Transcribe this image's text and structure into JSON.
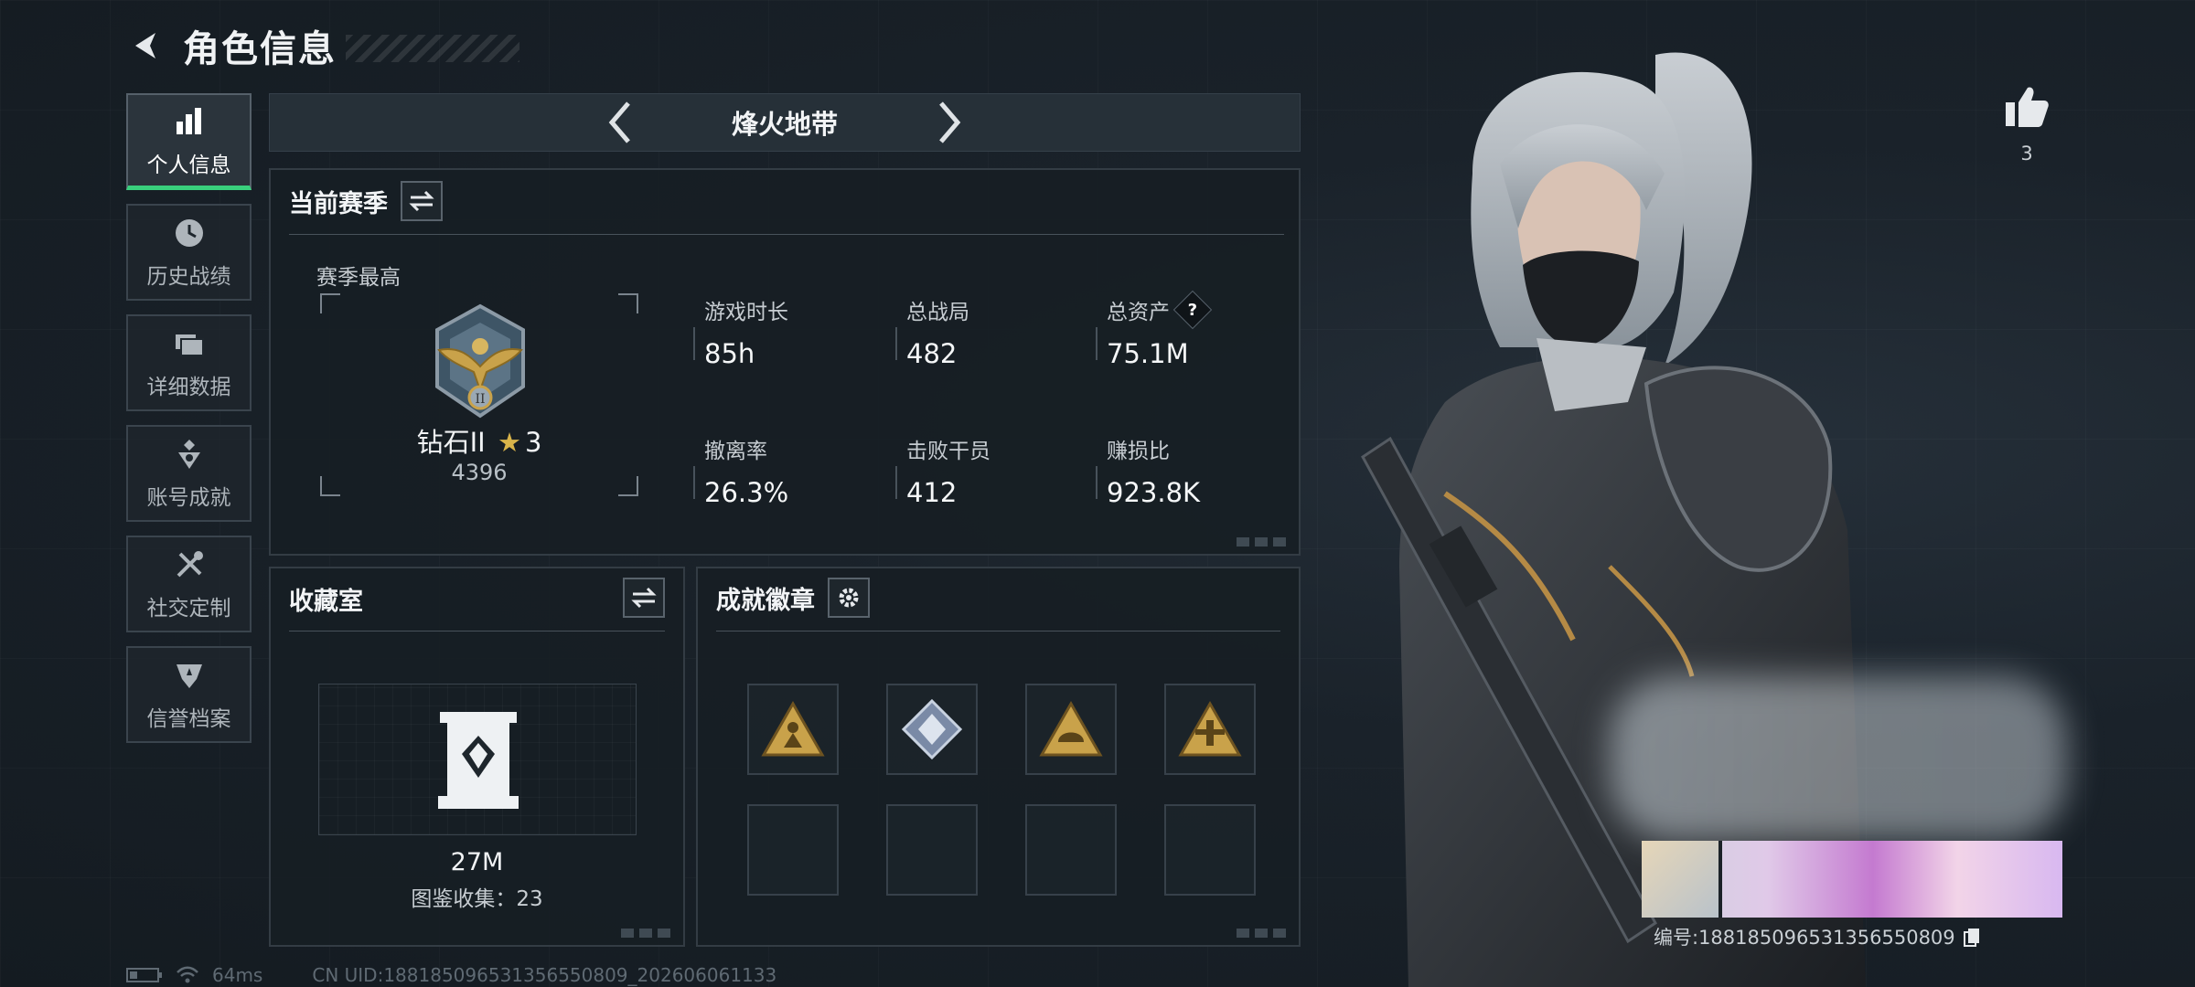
{
  "header": {
    "title": "角色信息"
  },
  "nav": [
    {
      "label": "个人信息",
      "icon": "bar-chart-icon"
    },
    {
      "label": "历史战绩",
      "icon": "clock-icon"
    },
    {
      "label": "详细数据",
      "icon": "folder-icon"
    },
    {
      "label": "账号成就",
      "icon": "trophy-icon"
    },
    {
      "label": "社交定制",
      "icon": "tools-icon"
    },
    {
      "label": "信誉档案",
      "icon": "shield-badge-icon"
    }
  ],
  "mode": {
    "title": "烽火地带"
  },
  "season": {
    "title": "当前赛季",
    "best_label": "赛季最高",
    "rank_name": "钻石II",
    "rank_stars": "3",
    "rank_score": "4396",
    "stats": [
      {
        "label": "游戏时长",
        "value": "85h"
      },
      {
        "label": "总战局",
        "value": "482"
      },
      {
        "label": "总资产",
        "value": "75.1M"
      },
      {
        "label": "撤离率",
        "value": "26.3%"
      },
      {
        "label": "击败干员",
        "value": "412"
      },
      {
        "label": "赚损比",
        "value": "923.8K"
      }
    ],
    "help_icon": "?"
  },
  "collection": {
    "title": "收藏室",
    "value": "27M",
    "count_text": "图鉴收集：23"
  },
  "badges": {
    "title": "成就徽章",
    "items": [
      "badge-soldier",
      "badge-diamond",
      "badge-helmet",
      "badge-plane"
    ]
  },
  "like": {
    "count": "3"
  },
  "profile": {
    "id_text": "编号:18818509653135655080​9"
  },
  "footer": {
    "ping": "64ms",
    "uid": "CN UID:18818509653135655080​9_202606061133"
  },
  "colors": {
    "accent": "#39d07d",
    "gold": "#c9a24a",
    "panel": "#171e24"
  }
}
